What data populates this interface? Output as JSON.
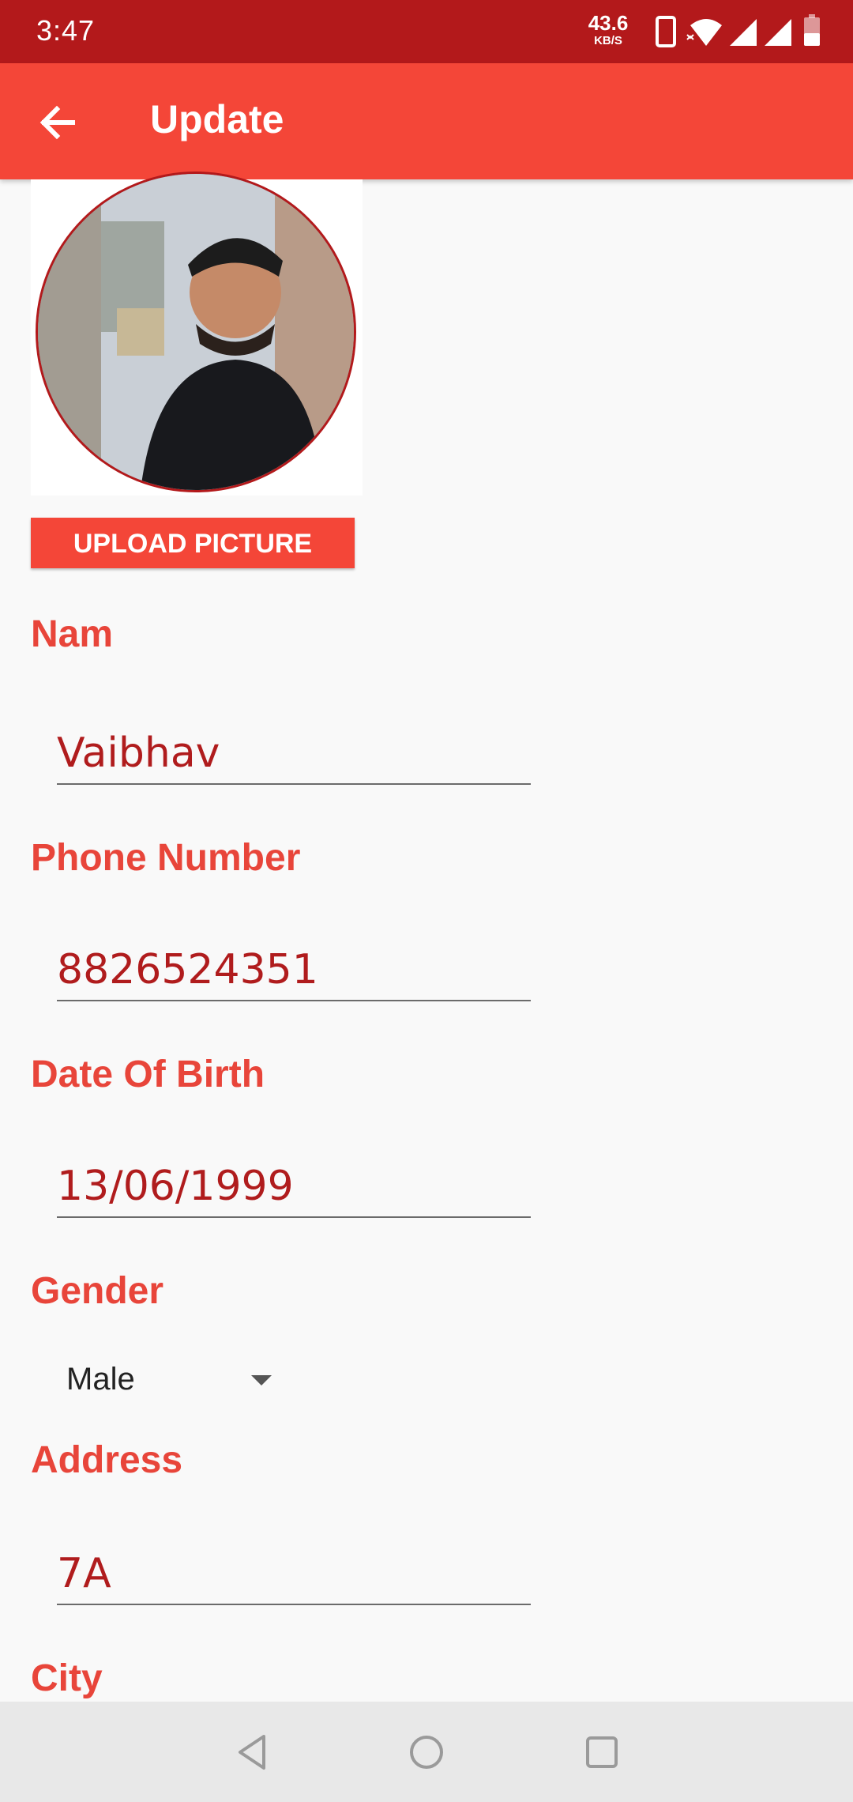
{
  "status_bar": {
    "time": "3:47",
    "net_speed_value": "43.6",
    "net_speed_unit": "KB/S",
    "icons": [
      "phone-icon",
      "wifi-icon",
      "signal-icon",
      "signal-icon",
      "battery-icon"
    ]
  },
  "app_bar": {
    "title": "Update",
    "back_icon": "arrow-left-icon",
    "background": "#f44638"
  },
  "profile": {
    "upload_label": "UPLOAD PICTURE"
  },
  "form": {
    "name_label": "Nam",
    "name_value": "Vaibhav",
    "phone_label": "Phone Number",
    "phone_value": "8826524351",
    "dob_label": "Date Of Birth",
    "dob_value": "13/06/1999",
    "gender_label": "Gender",
    "gender_value": "Male",
    "address_label": "Address",
    "address_value": "7A",
    "city_label": "City"
  },
  "nav_bar": {
    "icons": [
      "back-triangle-icon",
      "home-circle-icon",
      "recents-square-icon"
    ]
  },
  "colors": {
    "status_bar": "#b3191b",
    "accent": "#f44638",
    "label": "#e8453a",
    "value": "#b01c1d"
  }
}
